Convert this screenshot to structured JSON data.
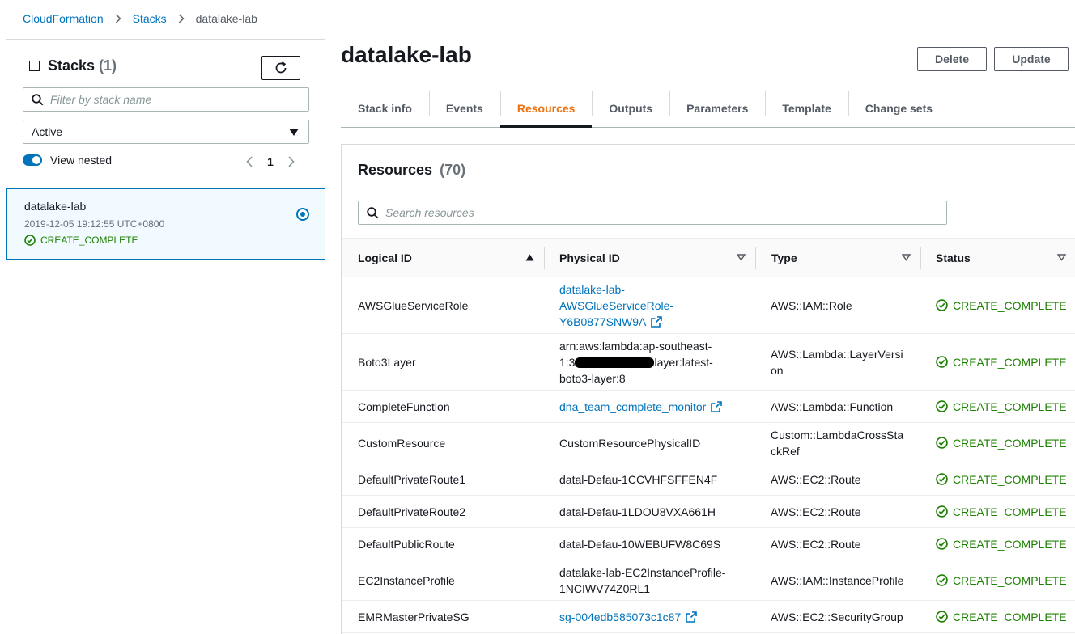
{
  "breadcrumb": {
    "root": "CloudFormation",
    "section": "Stacks",
    "current": "datalake-lab"
  },
  "stacks_panel": {
    "title": "Stacks",
    "count": "(1)",
    "filter_placeholder": "Filter by stack name",
    "status_filter": "Active",
    "view_nested_label": "View nested",
    "view_nested_on": true,
    "page": "1",
    "stack": {
      "name": "datalake-lab",
      "created": "2019-12-05 19:12:55 UTC+0800",
      "status": "CREATE_COMPLETE"
    }
  },
  "stack_detail": {
    "title": "datalake-lab",
    "delete_label": "Delete",
    "update_label": "Update",
    "tabs": [
      "Stack info",
      "Events",
      "Resources",
      "Outputs",
      "Parameters",
      "Template",
      "Change sets"
    ],
    "active_tab": "Resources"
  },
  "resources": {
    "title": "Resources",
    "count": "(70)",
    "search_placeholder": "Search resources",
    "columns": [
      "Logical ID",
      "Physical ID",
      "Type",
      "Status"
    ],
    "rows": [
      {
        "logical": "AWSGlueServiceRole",
        "physical_lines": [
          "datalake-lab-",
          "AWSGlueServiceRole-",
          "Y6B0877SNW9A"
        ],
        "link": true,
        "type_lines": [
          "AWS::IAM::Role"
        ],
        "status": "CREATE_COMPLETE"
      },
      {
        "logical": "Boto3Layer",
        "physical_lines": [
          "arn:aws:lambda:ap-southeast-",
          "1:3",
          "layer:latest-",
          "boto3-layer:8"
        ],
        "link": false,
        "redacted": true,
        "type_lines": [
          "AWS::Lambda::LayerVersi",
          "on"
        ],
        "status": "CREATE_COMPLETE"
      },
      {
        "logical": "CompleteFunction",
        "physical_lines": [
          "dna_team_complete_monitor"
        ],
        "link": true,
        "type_lines": [
          "AWS::Lambda::Function"
        ],
        "status": "CREATE_COMPLETE"
      },
      {
        "logical": "CustomResource",
        "physical_lines": [
          "CustomResourcePhysicalID"
        ],
        "link": false,
        "type_lines": [
          "Custom::LambdaCrossSta",
          "ckRef"
        ],
        "status": "CREATE_COMPLETE"
      },
      {
        "logical": "DefaultPrivateRoute1",
        "physical_lines": [
          "datal-Defau-1CCVHFSFFEN4F"
        ],
        "link": false,
        "type_lines": [
          "AWS::EC2::Route"
        ],
        "status": "CREATE_COMPLETE"
      },
      {
        "logical": "DefaultPrivateRoute2",
        "physical_lines": [
          "datal-Defau-1LDOU8VXA661H"
        ],
        "link": false,
        "type_lines": [
          "AWS::EC2::Route"
        ],
        "status": "CREATE_COMPLETE"
      },
      {
        "logical": "DefaultPublicRoute",
        "physical_lines": [
          "datal-Defau-10WEBUFW8C69S"
        ],
        "link": false,
        "type_lines": [
          "AWS::EC2::Route"
        ],
        "status": "CREATE_COMPLETE"
      },
      {
        "logical": "EC2InstanceProfile",
        "physical_lines": [
          "datalake-lab-EC2InstanceProfile-",
          "1NCIWV74Z0RL1"
        ],
        "link": false,
        "type_lines": [
          "AWS::IAM::InstanceProfile"
        ],
        "status": "CREATE_COMPLETE"
      },
      {
        "logical": "EMRMasterPrivateSG",
        "physical_lines": [
          "sg-004edb585073c1c87"
        ],
        "link": true,
        "type_lines": [
          "AWS::EC2::SecurityGroup"
        ],
        "status": "CREATE_COMPLETE"
      }
    ]
  },
  "colors": {
    "link": "#0073bb",
    "success": "#1d8102",
    "active_tab": "#ec7211"
  }
}
